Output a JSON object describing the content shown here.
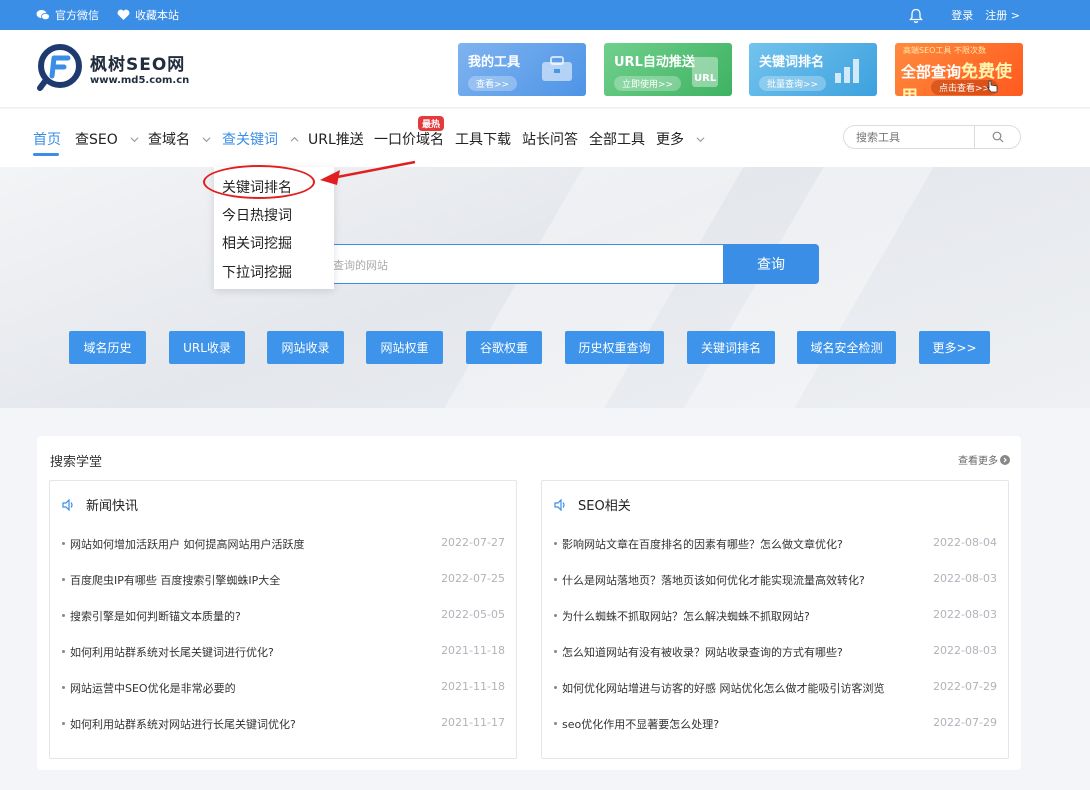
{
  "topbar": {
    "wechat": "官方微信",
    "bookmark": "收藏本站",
    "login": "登录",
    "register": "注册 >"
  },
  "logo": {
    "name": "枫树SEO网",
    "url": "www.md5.com.cn"
  },
  "banners": [
    {
      "title": "我的工具",
      "button": "查看>>"
    },
    {
      "title": "URL自动推送",
      "button": "立即使用>>"
    },
    {
      "title": "关键词排名",
      "button": "批量查询>>"
    },
    {
      "top": "高端SEO工具 不限次数",
      "title_a": "全部查询",
      "title_b": "免费使用",
      "button": "点击查看>>"
    }
  ],
  "nav": {
    "items": [
      "首页",
      "查SEO",
      "查域名",
      "查关键词",
      "URL推送",
      "一口价域名",
      "工具下载",
      "站长问答",
      "全部工具",
      "更多"
    ],
    "hot_badge": "最热",
    "search_placeholder": "搜索工具"
  },
  "dropdown": {
    "items": [
      "关键词排名",
      "今日热搜词",
      "相关词挖掘",
      "下拉词挖掘"
    ]
  },
  "hero": {
    "search_placeholder": "查询的网站",
    "query_button": "查询",
    "quick_buttons": [
      "域名历史",
      "URL收录",
      "网站收录",
      "网站权重",
      "谷歌权重",
      "历史权重查询",
      "关键词排名",
      "域名安全检测",
      "更多>>"
    ]
  },
  "content": {
    "title": "搜索学堂",
    "more": "查看更多",
    "news": {
      "title": "新闻快讯",
      "rows": [
        {
          "text": "网站如何增加活跃用户 如何提高网站用户活跃度",
          "date": "2022-07-27"
        },
        {
          "text": "百度爬虫IP有哪些 百度搜索引擎蜘蛛IP大全",
          "date": "2022-07-25"
        },
        {
          "text": "搜索引擎是如何判断锚文本质量的?",
          "date": "2022-05-05"
        },
        {
          "text": "如何利用站群系统对长尾关键词进行优化?",
          "date": "2021-11-18"
        },
        {
          "text": "网站运营中SEO优化是非常必要的",
          "date": "2021-11-18"
        },
        {
          "text": "如何利用站群系统对网站进行长尾关键词优化?",
          "date": "2021-11-17"
        }
      ]
    },
    "seo": {
      "title": "SEO相关",
      "rows": [
        {
          "text": "影响网站文章在百度排名的因素有哪些？怎么做文章优化?",
          "date": "2022-08-04"
        },
        {
          "text": "什么是网站落地页？落地页该如何优化才能实现流量高效转化?",
          "date": "2022-08-03"
        },
        {
          "text": "为什么蜘蛛不抓取网站？怎么解决蜘蛛不抓取网站?",
          "date": "2022-08-03"
        },
        {
          "text": "怎么知道网站有没有被收录？网站收录查询的方式有哪些?",
          "date": "2022-08-03"
        },
        {
          "text": "如何优化网站增进与访客的好感 网站优化怎么做才能吸引访客浏览",
          "date": "2022-07-29"
        },
        {
          "text": "seo优化作用不显著要怎么处理?",
          "date": "2022-07-29"
        }
      ]
    }
  },
  "colors": {
    "brand": "#3a8ee6",
    "highlight": "#e02020"
  }
}
